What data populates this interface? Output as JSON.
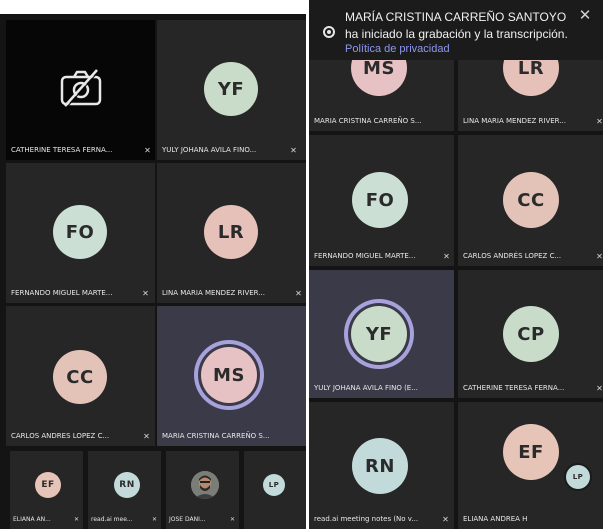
{
  "left_screenshot": {
    "tiles": [
      {
        "label": "CATHERINE TERESA FERNA...",
        "camera_off": true
      },
      {
        "initials": "YF",
        "label": "YULY JOHANA AVILA FINO...",
        "color": "#c9dcc9"
      },
      {
        "initials": "FO",
        "label": "FERNANDO MIGUEL MARTE...",
        "color": "#cbdfd4"
      },
      {
        "initials": "LR",
        "label": "LINA MARIA MENDEZ RIVER...",
        "color": "#e6c1b9"
      },
      {
        "initials": "CC",
        "label": "CARLOS ANDRES LOPEZ C...",
        "color": "#e3c3b8"
      },
      {
        "initials": "MS",
        "label": "MARIA CRISTINA CARREÑO S...",
        "color": "#e7c2c4",
        "active": true
      }
    ],
    "mini_tiles": [
      {
        "initials": "EF",
        "label": "ELIANA AN...",
        "color": "#e7c4b8"
      },
      {
        "initials": "RN",
        "label": "read.ai mee...",
        "color": "#c3dada"
      },
      {
        "label": "JOSE DANI...",
        "photo": true
      },
      {
        "initials": "LP",
        "label": "",
        "color": "#c3dada"
      }
    ]
  },
  "right_screenshot": {
    "notification": {
      "title": "MARÍA CRISTINA  CARREÑO SANTOYO",
      "message": "ha iniciado la grabación y la transcripción.",
      "link": "Política de privacidad",
      "close_icon": "close-icon"
    },
    "tiles": [
      {
        "initials": "MS",
        "label": "MARIA CRISTINA  CARREÑO S...",
        "color": "#e7c2c4"
      },
      {
        "initials": "LR",
        "label": "LINA MARIA MENDEZ RIVER...",
        "color": "#e6c1b9"
      },
      {
        "initials": "FO",
        "label": "FERNANDO MIGUEL MARTE...",
        "color": "#cbdfd4"
      },
      {
        "initials": "CC",
        "label": "CARLOS ANDRÉS  LOPEZ C...",
        "color": "#e3c3b8"
      },
      {
        "initials": "YF",
        "label": "YULY JOHANA  AVILA FINO (E...",
        "color": "#c9dcc9",
        "active": true
      },
      {
        "initials": "CP",
        "label": "CATHERINE TERESA FERNA...",
        "color": "#c9dcc9"
      },
      {
        "initials": "RN",
        "label": "read.ai meeting notes (No v...",
        "color": "#c3dada"
      },
      {
        "initials": "EF",
        "label": "ELIANA ANDREA  H",
        "color": "#e7c4b8"
      }
    ],
    "overlay_avatar": {
      "initials": "LP",
      "color": "#c3dada"
    }
  }
}
